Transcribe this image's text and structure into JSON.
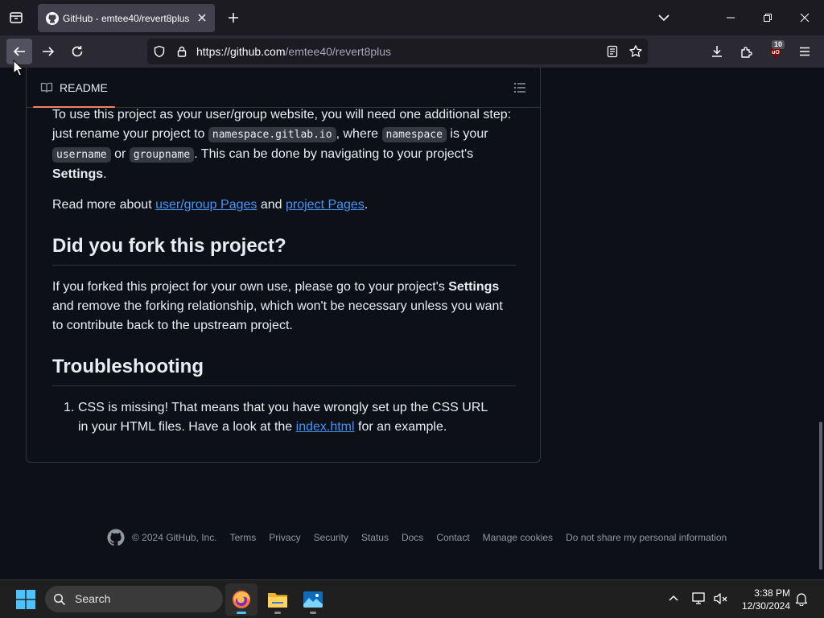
{
  "browser": {
    "tab_title": "GitHub - emtee40/revert8plus",
    "url_host": "https://github.com",
    "url_path": "/emtee40/revert8plus",
    "ublock_count": "10"
  },
  "readme": {
    "tab_label": "README",
    "p1": {
      "t1": "To use this project as your user/group website, you will need one additional step: just rename your project to ",
      "c1": "namespace.gitlab.io",
      "t2": ", where ",
      "c2": "namespace",
      "t3": " is your ",
      "c3": "username",
      "t4": " or ",
      "c4": "groupname",
      "t5": ". This can be done by navigating to your project's ",
      "b1": "Settings",
      "t6": "."
    },
    "p2": {
      "t1": "Read more about ",
      "a1": "user/group Pages",
      "t2": " and ",
      "a2": "project Pages",
      "t3": "."
    },
    "h_fork": "Did you fork this project?",
    "p3": {
      "t1": "If you forked this project for your own use, please go to your project's ",
      "b1": "Settings",
      "t2": " and remove the forking relationship, which won't be necessary unless you want to contribute back to the upstream project."
    },
    "h_trouble": "Troubleshooting",
    "li1": {
      "num": "1.",
      "t1": "CSS is missing! That means that you have wrongly set up the CSS URL in your HTML files. Have a look at the ",
      "a1": "index.html",
      "t2": " for an example."
    }
  },
  "footer": {
    "copyright": "© 2024 GitHub, Inc.",
    "links": [
      "Terms",
      "Privacy",
      "Security",
      "Status",
      "Docs",
      "Contact",
      "Manage cookies",
      "Do not share my personal information"
    ]
  },
  "taskbar": {
    "search_label": "Search",
    "time": "3:38 PM",
    "date": "12/30/2024"
  },
  "colors": {
    "page_bg": "#0d1117",
    "link": "#4493f8",
    "tab_underline": "#f78166",
    "browser_chrome": "#2b2a33"
  }
}
